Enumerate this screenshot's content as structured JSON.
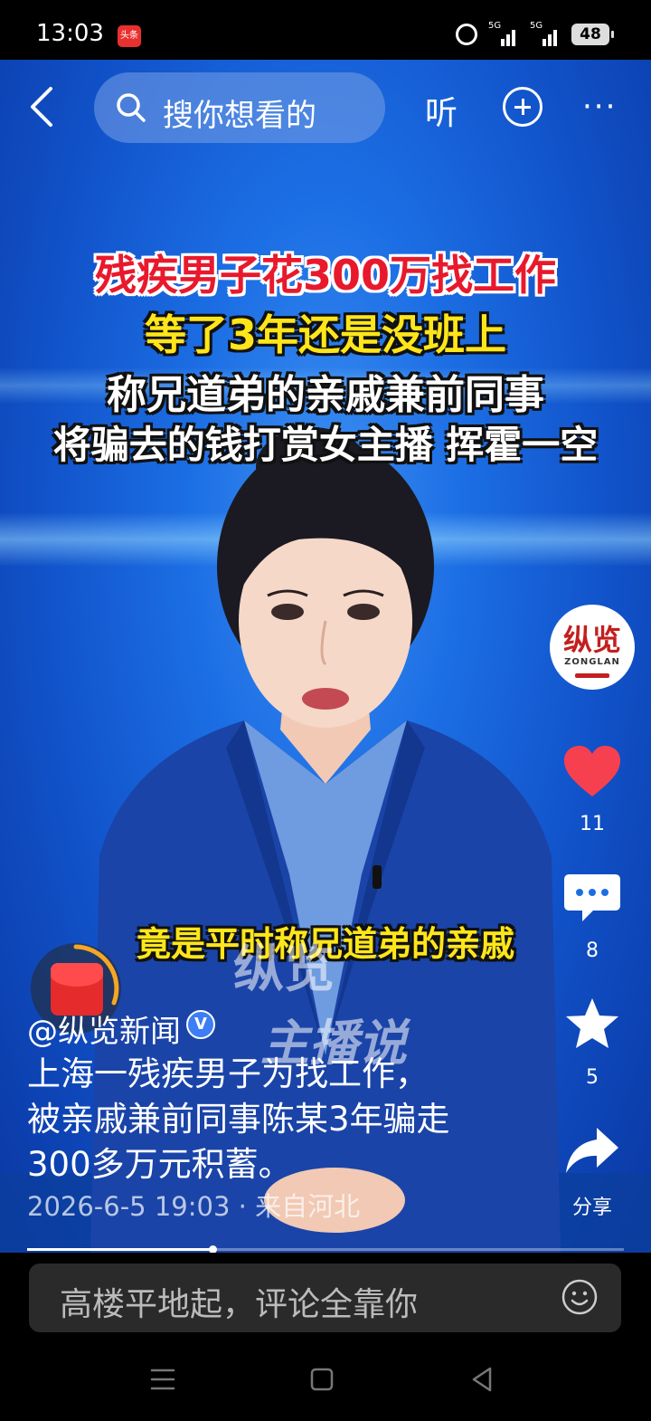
{
  "status_bar": {
    "time": "13:03",
    "app_badge": "头条",
    "signal_1": "5G",
    "signal_2": "5G",
    "battery": "48"
  },
  "header": {
    "search_placeholder": "搜你想看的",
    "listen_label": "听",
    "more_label": "···"
  },
  "video": {
    "headline_line1": "残疾男子花300万找工作",
    "headline_line2": "等了3年还是没班上",
    "headline_line3": "称兄道弟的亲戚兼前同事",
    "headline_line4": "将骗去的钱打赏女主播 挥霍一空",
    "subtitle": "竟是平时称兄道弟的亲戚",
    "watermark_line1": "纵览",
    "watermark_line2": "主播说",
    "progress_fraction": 0.31
  },
  "right_rail": {
    "logo_cn": "纵览",
    "logo_en": "ZONGLAN",
    "like_count": "11",
    "comment_count": "8",
    "favorite_count": "5",
    "share_label": "分享"
  },
  "post": {
    "author": "@纵览新闻",
    "verified_badge": "V",
    "description_lines": [
      "上海一残疾男子为找工作，",
      "被亲戚兼前同事陈某3年骗走",
      "300多万元积蓄。"
    ],
    "meta": "2026-6-5 19:03 · 来自河北"
  },
  "comment_bar": {
    "placeholder": "高楼平地起，评论全靠你"
  },
  "colors": {
    "headline_red": "#e8192c",
    "headline_yellow": "#ffe61a",
    "like_red": "#f6404f",
    "video_blue": "#1c6ee4",
    "verified_blue": "#3d7df5"
  }
}
